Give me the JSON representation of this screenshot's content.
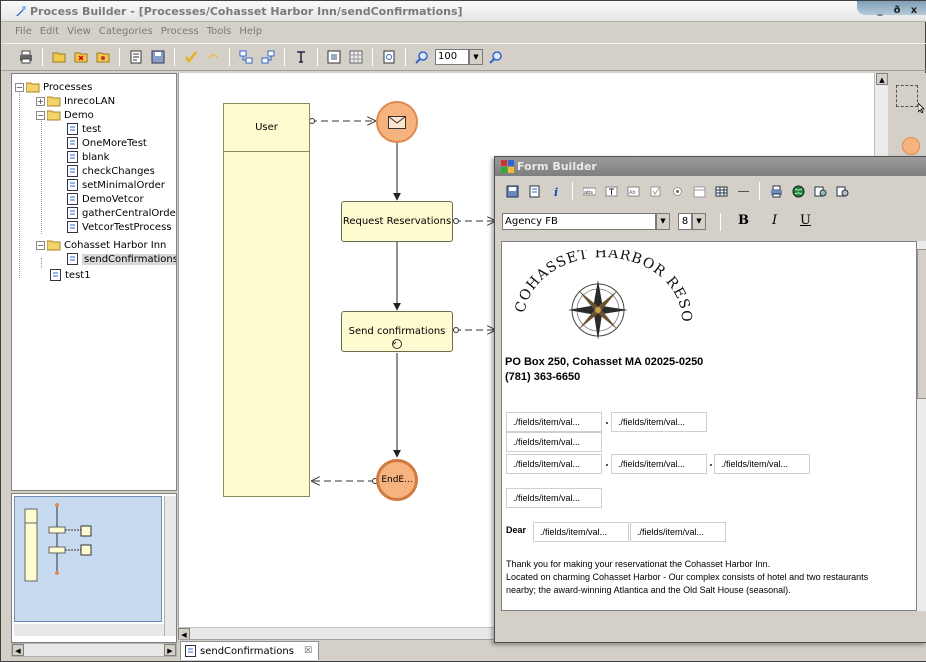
{
  "window": {
    "title": "Process Builder - [Processes/Cohasset Harbor Inn/sendConfirmations]",
    "buttons": {
      "minimize": "_",
      "restore": "ð",
      "close": "x"
    }
  },
  "menu": [
    "File",
    "Edit",
    "View",
    "Categories",
    "Process",
    "Tools",
    "Help"
  ],
  "toolbar": {
    "zoom_value": "100"
  },
  "tree": {
    "root": "Processes",
    "items": [
      {
        "label": "InrecoLAN",
        "type": "folder"
      },
      {
        "label": "Demo",
        "type": "folder"
      },
      {
        "label": "test",
        "type": "process"
      },
      {
        "label": "OneMoreTest",
        "type": "process"
      },
      {
        "label": "blank",
        "type": "process"
      },
      {
        "label": "checkChanges",
        "type": "process"
      },
      {
        "label": "setMinimalOrder",
        "type": "process"
      },
      {
        "label": "DemoVetcor",
        "type": "process"
      },
      {
        "label": "gatherCentralOrder",
        "type": "process"
      },
      {
        "label": "VetcorTestProcess",
        "type": "process"
      },
      {
        "label": "Cohasset Harbor Inn",
        "type": "folder"
      },
      {
        "label": "sendConfirmations",
        "type": "process"
      },
      {
        "label": "test1",
        "type": "process"
      }
    ]
  },
  "diagram": {
    "lane": "User",
    "tasks": [
      "Request Reservations",
      "Send confirmations"
    ],
    "end_event": "EndE..."
  },
  "editor_tab": {
    "label": "sendConfirmations",
    "close": "☒"
  },
  "form_builder": {
    "title": "Form Builder",
    "font": "Agency FB",
    "font_size": "8",
    "format": {
      "bold": "B",
      "italic": "I",
      "underline": "U"
    },
    "logo_text": "COHASSET HARBOR RESORT",
    "address_line1": "PO Box 250, Cohasset MA 02025-0250",
    "address_line2": "(781) 363-6650",
    "field_placeholder": "./fields/item/val...",
    "dear_label": "Dear",
    "body_lines": [
      "Thank you for making your reservationat the Cohasset Harbor Inn.",
      "Located on charming Cohasset Harbor - Our complex consists of hotel and two restaurants",
      "nearby; the award-winning Atlantica and the Old Salt House (seasonal)."
    ]
  },
  "colors": {
    "lane_fill": "#fdfbcf",
    "event_fill": "#f7b37e",
    "event_border": "#e08a50",
    "overview_fill": "#c8daf0"
  }
}
